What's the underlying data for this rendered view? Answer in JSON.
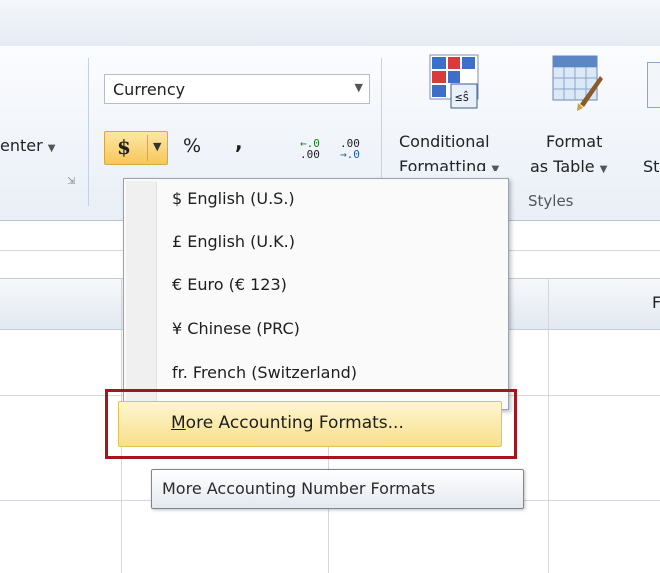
{
  "ribbon": {
    "alignment_group": {
      "merge_center_label": "enter"
    },
    "number_group": {
      "format_value": "Currency",
      "accounting_symbol": "$",
      "percent_symbol": "%",
      "comma_symbol": ",",
      "increase_decimal_top": "←.0",
      "increase_decimal_bottom": ".00",
      "decrease_decimal_top": ".00",
      "decrease_decimal_bottom": "→.0"
    },
    "styles_group": {
      "conditional_formatting_line1": "Conditional",
      "conditional_formatting_line2": "Formatting",
      "format_as_table_line1": "Format",
      "format_as_table_line2": "as Table",
      "cell_styles_cut": "St",
      "group_label": "Styles"
    }
  },
  "menu": {
    "items": [
      "$ English (U.S.)",
      "£ English (U.K.)",
      "€ Euro (€ 123)",
      "¥ Chinese (PRC)",
      "fr. French (Switzerland)"
    ],
    "more_formats": "More Accounting Formats...",
    "tooltip": "More Accounting Number Formats"
  },
  "grid": {
    "column_header_fragment": "F"
  },
  "colors": {
    "highlight_border": "#a2161e",
    "button_gold": "#f7c75a",
    "ribbon_bg": "#e9eff7"
  },
  "icons": [
    "dropdown-arrow-icon",
    "dialog-launcher-icon",
    "conditional-formatting-icon",
    "format-as-table-icon",
    "increase-decimal-icon",
    "decrease-decimal-icon"
  ]
}
